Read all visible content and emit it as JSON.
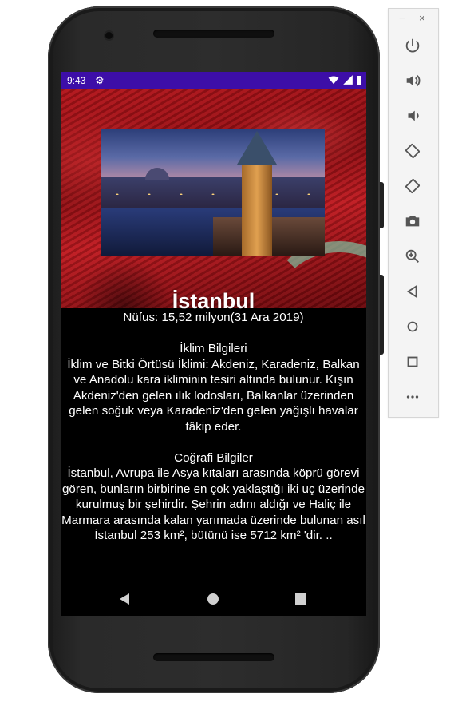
{
  "status_bar": {
    "time": "9:43",
    "settings_icon": "gear-icon",
    "wifi_icon": "wifi-icon",
    "signal_icon": "signal-icon",
    "battery_icon": "battery-icon",
    "color": "#3d0ea8"
  },
  "header": {
    "title": "İstanbul",
    "image_icon": "galata-tower-photo"
  },
  "content": {
    "population": "Nüfus: 15,52 milyon(31 Ara 2019)",
    "climate_heading": "İklim Bilgileri",
    "climate_text": "İklim ve Bitki Örtüsü İklimi: Akdeniz, Karadeniz, Balkan ve Anadolu kara ikliminin tesiri altında bulunur. Kışın Akdeniz'den gelen ılık lodosları, Balkanlar üzerinden gelen soğuk veya Karadeniz'den gelen yağışlı havalar tâkip eder.",
    "geo_heading": "Coğrafi Bilgiler",
    "geo_text": "İstanbul, Avrupa ile Asya kıtaları arasında köprü görevi gören, bunların birbirine en çok yaklaştığı iki uç üzerinde kurulmuş bir şehirdir. Şehrin adını aldığı ve Haliç ile Marmara arasında kalan yarımada üzerinde bulunan asıl İstanbul 253 km², bütünü ise 5712 km² 'dir. .."
  },
  "nav_bar": {
    "back_icon": "back-icon",
    "home_icon": "home-icon",
    "recents_icon": "recents-icon"
  },
  "emulator_toolbar": {
    "minimize": "−",
    "close": "×",
    "buttons": [
      "power-icon",
      "volume-up-icon",
      "volume-down-icon",
      "rotate-left-icon",
      "rotate-right-icon",
      "camera-icon",
      "zoom-icon",
      "back-icon",
      "home-icon",
      "overview-icon",
      "more-icon"
    ]
  }
}
